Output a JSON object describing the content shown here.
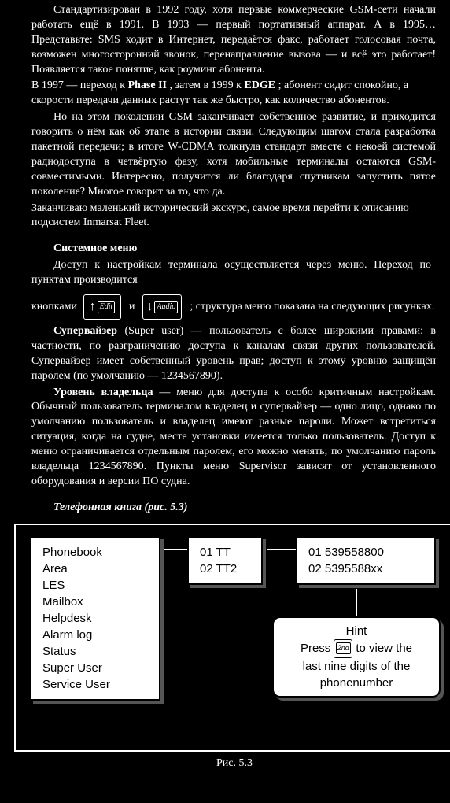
{
  "para1": "Стандартизирован в 1992 году, хотя первые коммерческие GSM-сети начали работать ещё в 1991. В 1993 — первый портативный аппарат. А в 1995… Представьте: SMS ходит в Интернет, передаётся факс, работает голосовая почта, возможен многосторонний звонок, перенаправление вызова — и всё это работает! Появляется такое понятие, как роуминг абонента.",
  "para2a": "В 1997 — переход к",
  "para2b": ", затем в 1999 к",
  "para2c": "; абонент сидит спокойно, а скорости передачи данных растут так же быстро, как количество абонентов.",
  "bold_phase": "Phase II",
  "bold_edge": "EDGE",
  "para3": "Но на этом поколении GSM заканчивает собственное развитие, и приходится говорить о нём как об этапе в истории связи. Следующим шагом стала разработка пакетной передачи; в итоге W-CDMA толкнула стандарт вместе с некоей системой радиодоступа в четвёртую фазу, хотя мобильные терминалы остаются GSM-совместимыми. Интересно, получится ли благодаря спутникам запустить пятое поколение? Многое говорит за то, что да.",
  "para4": "Заканчиваю маленький исторический экскурс, самое время перейти к описанию подсистем Inmarsat Fleet.",
  "menu_title": "Системное меню",
  "menu_intro": "Доступ к настройкам терминала осуществляется через меню. Переход по пунктам производится",
  "keys_and": "и",
  "keys_tail": "; структура меню показана на следующих рисунках.",
  "key1": "Edit",
  "key2": "Audio",
  "super_title": "Супервайзер",
  "para5": "(Super user) — пользователь с более широкими правами: в частности, по разграничению доступа к каналам связи других пользователей. Супервайзер имеет собственный уровень прав; доступ к этому уровню защищён паролем (по умолчанию — 1234567890).",
  "owner_title": "Уровень владельца",
  "para6": "— меню для доступа к особо критичным настройкам. Обычный пользователь терминалом владелец и супервайзер — одно лицо, однако по умолчанию пользователь и владелец имеют разные пароли. Может встретиться ситуация, когда на судне, месте установки имеется только пользователь. Доступ к меню ограничивается отдельным паролем, его можно менять; по умолчанию пароль владельца 1234567890. Пункты меню Supervisor зависят от установленного оборудования и версии ПО судна.",
  "phonebook_title": "Телефонная книга (рис. 5.3)",
  "menu_items": [
    "Phonebook",
    "Area",
    "LES",
    "Mailbox",
    "Helpdesk",
    "Alarm log",
    "Status",
    "Super User",
    "Service User"
  ],
  "tt_items": [
    "01 TT",
    "02 TT2"
  ],
  "num_items": [
    "01 539558800",
    "02 5395588xx"
  ],
  "hint_title": "Hint",
  "hint_press": "Press",
  "hint_tail1": "to view the",
  "hint_tail2": "last nine digits of the",
  "hint_tail3": "phonenumber",
  "hint_key": "2nd",
  "fig_caption": "Рис. 5.3"
}
